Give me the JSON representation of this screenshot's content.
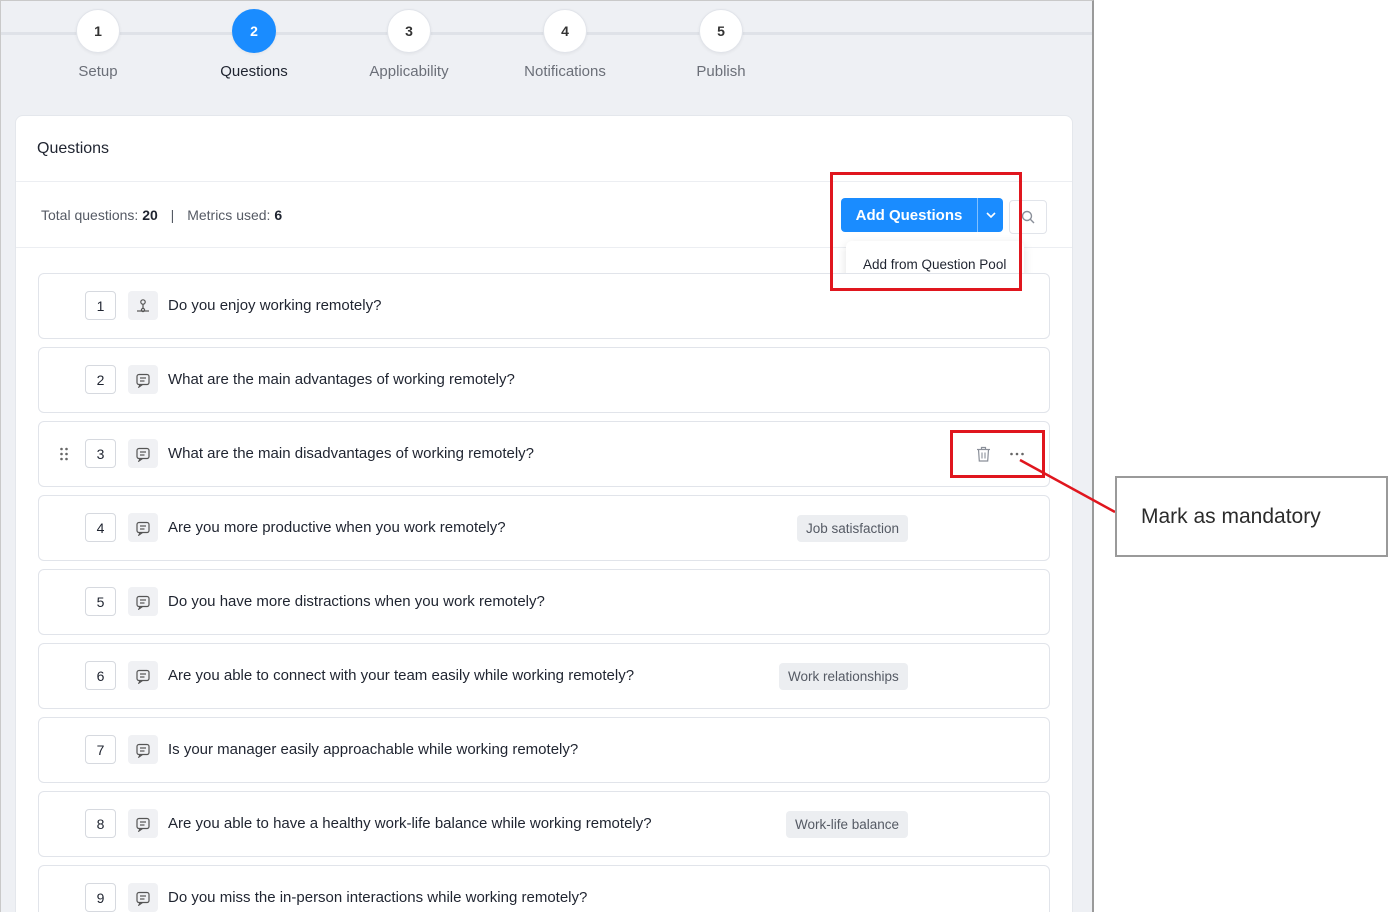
{
  "stepper": {
    "steps": [
      {
        "number": "1",
        "label": "Setup"
      },
      {
        "number": "2",
        "label": "Questions"
      },
      {
        "number": "3",
        "label": "Applicability"
      },
      {
        "number": "4",
        "label": "Notifications"
      },
      {
        "number": "5",
        "label": "Publish"
      }
    ],
    "active_step": "2"
  },
  "card": {
    "title": "Questions",
    "summary": {
      "total_label": "Total questions:",
      "total_value": "20",
      "separator": "|",
      "metrics_label": "Metrics used:",
      "metrics_value": "6"
    },
    "add_button_label": "Add Questions",
    "dropdown_option": "Add from Question Pool"
  },
  "questions": [
    {
      "number": "1",
      "icon": "rating-scale-icon",
      "text": "Do you enjoy working remotely?",
      "metric": ""
    },
    {
      "number": "2",
      "icon": "text-question-icon",
      "text": "What are the main advantages of working remotely?",
      "metric": ""
    },
    {
      "number": "3",
      "icon": "text-question-icon",
      "text": "What are the main disadvantages of working remotely?",
      "metric": "",
      "hovered": true
    },
    {
      "number": "4",
      "icon": "text-question-icon",
      "text": "Are you more productive when you work remotely?",
      "metric": "Job satisfaction"
    },
    {
      "number": "5",
      "icon": "text-question-icon",
      "text": "Do you have more distractions when you work remotely?",
      "metric": ""
    },
    {
      "number": "6",
      "icon": "text-question-icon",
      "text": "Are you able to connect with your team easily while working remotely?",
      "metric": "Work relationships"
    },
    {
      "number": "7",
      "icon": "text-question-icon",
      "text": "Is your manager easily approachable while working remotely?",
      "metric": ""
    },
    {
      "number": "8",
      "icon": "text-question-icon",
      "text": "Are you able to have a healthy work-life balance while working remotely?",
      "metric": "Work-life balance"
    },
    {
      "number": "9",
      "icon": "text-question-icon",
      "text": "Do you miss the in-person interactions while working remotely?",
      "metric": ""
    }
  ],
  "annotation": {
    "callout_text": "Mark as mandatory"
  },
  "colors": {
    "accent": "#1a8cff",
    "highlight": "#e0161e",
    "page_background": "#eef0f4"
  }
}
